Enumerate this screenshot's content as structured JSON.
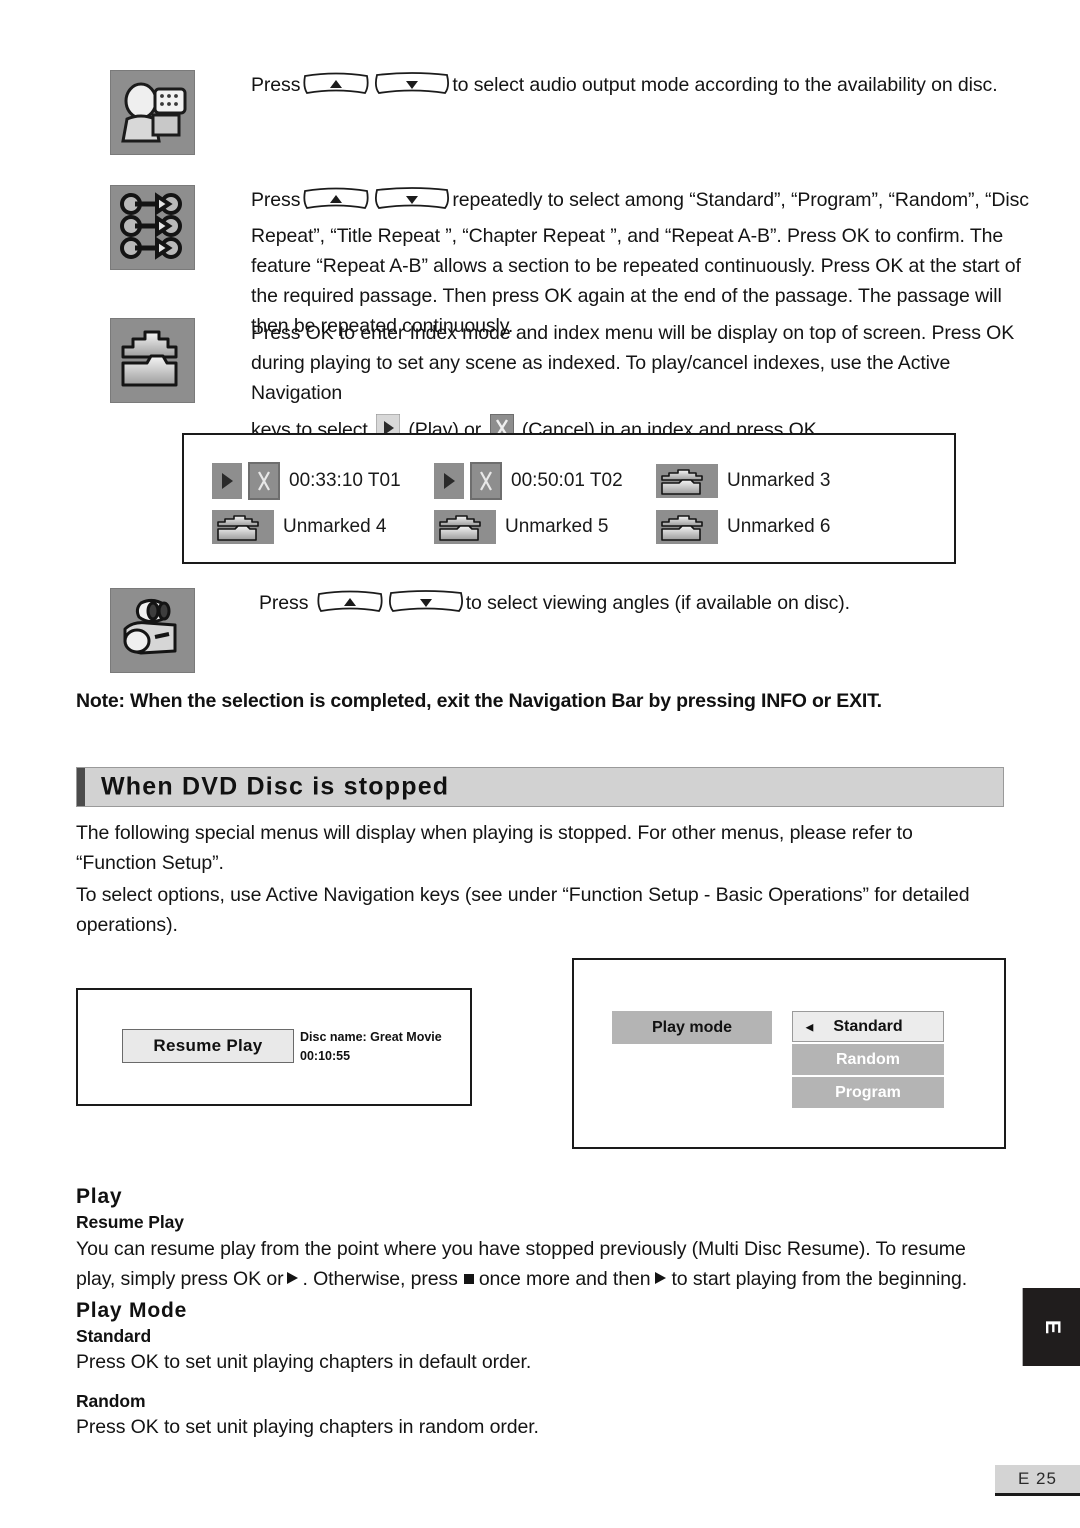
{
  "instructions": [
    {
      "icon": "audio-output-icon",
      "text_before_keys": "Press",
      "keys": [
        "up-arrow-key",
        "down-arrow-key"
      ],
      "text_after_keys": "to select audio output mode according to the availability on disc."
    },
    {
      "icon": "repeat-mode-icon",
      "text_before_keys": "Press",
      "keys": [
        "up-arrow-key",
        "down-arrow-key"
      ],
      "text_after_keys": "repeatedly to select among “Standard”, “Program”, “Random”, “Disc Repeat”, “Title Repeat ”, “Chapter Repeat ”,  and “Repeat A-B”.  Press OK to confirm. The feature “Repeat A-B” allows a section to be repeated continuously.  Press OK at the start of the required passage.  Then press OK again at the end of the passage.  The passage will then be repeated continuously."
    },
    {
      "icon": "index-mark-icon",
      "paragraph": "Press OK to enter Index mode and index menu will be display on top of screen. Press OK during playing to set any scene as indexed. To play/cancel indexes, use the Active Navigation",
      "line_prefix": "keys to select",
      "play_label": "(Play) or",
      "cancel_label": "(Cancel) in an index and press OK."
    },
    {
      "icon": "camcorder-icon",
      "text_before_keys": "Press",
      "keys": [
        "up-arrow-key",
        "down-arrow-key"
      ],
      "text_after_keys": "to select viewing angles (if available on disc)."
    }
  ],
  "index_menu": {
    "cells": [
      {
        "type": "play-cancel",
        "label": "00:33:10 T01"
      },
      {
        "type": "play-cancel",
        "label": "00:50:01 T02"
      },
      {
        "type": "unmarked",
        "label": "Unmarked 3"
      },
      {
        "type": "unmarked",
        "label": "Unmarked 4"
      },
      {
        "type": "unmarked",
        "label": "Unmarked 5"
      },
      {
        "type": "unmarked",
        "label": "Unmarked 6"
      }
    ]
  },
  "note": "Note: When the selection is completed, exit the Navigation Bar by pressing INFO or EXIT.",
  "section": {
    "title": "When DVD Disc is stopped",
    "paragraph_1": "The following special menus will display when playing is stopped. For other menus, please refer to “Function Setup”.",
    "paragraph_2": "To select options, use Active Navigation keys (see under “Function Setup - Basic Operations” for detailed operations)."
  },
  "resume_screen": {
    "button_label": "Resume Play",
    "disc_name": "Disc name: Great Movie",
    "elapsed_time": "00:10:55"
  },
  "playmode_screen": {
    "button_label": "Play mode",
    "options": [
      {
        "label": "Standard",
        "selected": true
      },
      {
        "label": "Random",
        "selected": false
      },
      {
        "label": "Program",
        "selected": false
      }
    ],
    "selection_arrow": "◄"
  },
  "play_section": {
    "heading": "Play",
    "subheading": "Resume Play",
    "text_part_1": "You can resume play from the point where you have stopped previously (Multi Disc Resume). To resume play, simply press OK or",
    "text_part_2": ". Otherwise, press",
    "text_part_3": "once more and then",
    "text_part_4": "to start playing from the beginning."
  },
  "play_mode_section": {
    "heading": "Play Mode",
    "standard_heading": "Standard",
    "standard_text": "Press OK to set unit playing chapters in default order.",
    "random_heading": "Random",
    "random_text": "Press OK to set unit playing chapters in random order."
  },
  "side_tab_letter": "E",
  "footer_page": "E 25",
  "colors": {
    "thumb_background": "#8e8e8e",
    "section_bar": "#d2d2d2",
    "section_bar_accent": "#4b4b4b",
    "mode_unselected": "#b4b4b4",
    "mode_selected": "#ececec",
    "footer_background": "#d4d4d4",
    "side_tab_background": "#201d1d"
  }
}
